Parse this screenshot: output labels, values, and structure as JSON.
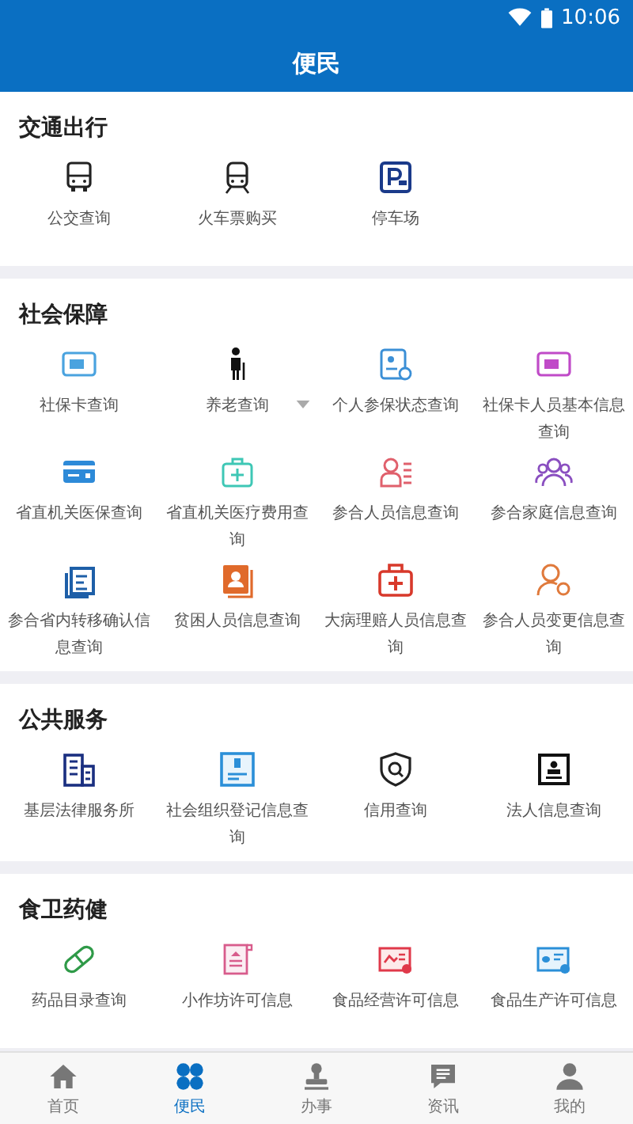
{
  "status_bar": {
    "time": "10:06"
  },
  "header": {
    "title": "便民"
  },
  "sections": [
    {
      "title": "交通出行",
      "items": [
        {
          "label": "公交查询",
          "expandable": false
        },
        {
          "label": "火车票购买",
          "expandable": false
        },
        {
          "label": "停车场",
          "expandable": false
        }
      ]
    },
    {
      "title": "社会保障",
      "items": [
        {
          "label": "社保卡查询",
          "expandable": false
        },
        {
          "label": "养老查询",
          "expandable": true
        },
        {
          "label": "个人参保状态查询",
          "expandable": false
        },
        {
          "label": "社保卡人员基本信息查询",
          "expandable": false
        },
        {
          "label": "省直机关医保查询",
          "expandable": false
        },
        {
          "label": "省直机关医疗费用查询",
          "expandable": false
        },
        {
          "label": "参合人员信息查询",
          "expandable": false
        },
        {
          "label": "参合家庭信息查询",
          "expandable": false
        },
        {
          "label": "参合省内转移确认信息查询",
          "expandable": false
        },
        {
          "label": "贫困人员信息查询",
          "expandable": false
        },
        {
          "label": "大病理赔人员信息查询",
          "expandable": false
        },
        {
          "label": "参合人员变更信息查询",
          "expandable": false
        }
      ]
    },
    {
      "title": "公共服务",
      "items": [
        {
          "label": "基层法律服务所",
          "expandable": false
        },
        {
          "label": "社会组织登记信息查询",
          "expandable": false
        },
        {
          "label": "信用查询",
          "expandable": false
        },
        {
          "label": "法人信息查询",
          "expandable": false
        }
      ]
    },
    {
      "title": "食卫药健",
      "items": [
        {
          "label": "药品目录查询",
          "expandable": false
        },
        {
          "label": "小作坊许可信息",
          "expandable": false
        },
        {
          "label": "食品经营许可信息",
          "expandable": false
        },
        {
          "label": "食品生产许可信息",
          "expandable": false
        }
      ]
    }
  ],
  "tabs": [
    {
      "label": "首页",
      "selected": false
    },
    {
      "label": "便民",
      "selected": true
    },
    {
      "label": "办事",
      "selected": false
    },
    {
      "label": "资讯",
      "selected": false
    },
    {
      "label": "我的",
      "selected": false
    }
  ]
}
